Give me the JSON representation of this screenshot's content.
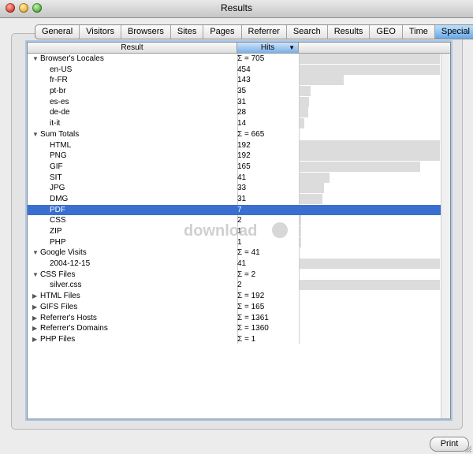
{
  "window": {
    "title": "Results"
  },
  "tabs": [
    {
      "label": "General",
      "selected": false
    },
    {
      "label": "Visitors",
      "selected": false
    },
    {
      "label": "Browsers",
      "selected": false
    },
    {
      "label": "Sites",
      "selected": false
    },
    {
      "label": "Pages",
      "selected": false
    },
    {
      "label": "Referrer",
      "selected": false
    },
    {
      "label": "Search",
      "selected": false
    },
    {
      "label": "Results",
      "selected": false
    },
    {
      "label": "GEO",
      "selected": false
    },
    {
      "label": "Time",
      "selected": false
    },
    {
      "label": "Special",
      "selected": true
    }
  ],
  "table": {
    "col_result": "Result",
    "col_hits": "Hits",
    "rows": [
      {
        "label": "Browser's Locales",
        "hits": "Σ = 705",
        "group": true,
        "expanded": true,
        "bar": 1.0
      },
      {
        "label": "en-US",
        "hits": "454",
        "bar": 1.0
      },
      {
        "label": "fr-FR",
        "hits": "143",
        "bar": 0.315
      },
      {
        "label": "pt-br",
        "hits": "35",
        "bar": 0.077
      },
      {
        "label": "es-es",
        "hits": "31",
        "bar": 0.068
      },
      {
        "label": "de-de",
        "hits": "28",
        "bar": 0.062
      },
      {
        "label": "it-it",
        "hits": "14",
        "bar": 0.031
      },
      {
        "label": "Sum Totals",
        "hits": "Σ = 665",
        "group": true,
        "expanded": true,
        "bar": 0
      },
      {
        "label": "HTML",
        "hits": "192",
        "bar": 1.0
      },
      {
        "label": "PNG",
        "hits": "192",
        "bar": 1.0
      },
      {
        "label": "GIF",
        "hits": "165",
        "bar": 0.86
      },
      {
        "label": "SIT",
        "hits": "41",
        "bar": 0.214
      },
      {
        "label": "JPG",
        "hits": "33",
        "bar": 0.172
      },
      {
        "label": "DMG",
        "hits": "31",
        "bar": 0.161
      },
      {
        "label": "PDF",
        "hits": "7",
        "bar": 0.036,
        "selected": true
      },
      {
        "label": "CSS",
        "hits": "2",
        "bar": 0.01
      },
      {
        "label": "ZIP",
        "hits": "1",
        "bar": 0.005
      },
      {
        "label": "PHP",
        "hits": "1",
        "bar": 0.005
      },
      {
        "label": "Google Visits",
        "hits": "Σ = 41",
        "group": true,
        "expanded": true,
        "bar": 0
      },
      {
        "label": "2004-12-15",
        "hits": "41",
        "bar": 1.0
      },
      {
        "label": "CSS Files",
        "hits": "Σ = 2",
        "group": true,
        "expanded": true,
        "bar": 0
      },
      {
        "label": "silver.css",
        "hits": "2",
        "bar": 1.0
      },
      {
        "label": "HTML Files",
        "hits": "Σ = 192",
        "group": true,
        "expanded": false,
        "bar": 0
      },
      {
        "label": "GIFS Files",
        "hits": "Σ = 165",
        "group": true,
        "expanded": false,
        "bar": 0
      },
      {
        "label": "Referrer's Hosts",
        "hits": "Σ = 1361",
        "group": true,
        "expanded": false,
        "bar": 0
      },
      {
        "label": "Referrer's Domains",
        "hits": "Σ = 1360",
        "group": true,
        "expanded": false,
        "bar": 0
      },
      {
        "label": "PHP Files",
        "hits": "Σ = 1",
        "group": true,
        "expanded": false,
        "bar": 0
      }
    ]
  },
  "watermark": {
    "text": "download"
  },
  "footer": {
    "print_label": "Print"
  },
  "colors": {
    "selection": "#3a6fd0",
    "bar": "#dcdcdc",
    "tab_selected": "#7fb5ec"
  }
}
